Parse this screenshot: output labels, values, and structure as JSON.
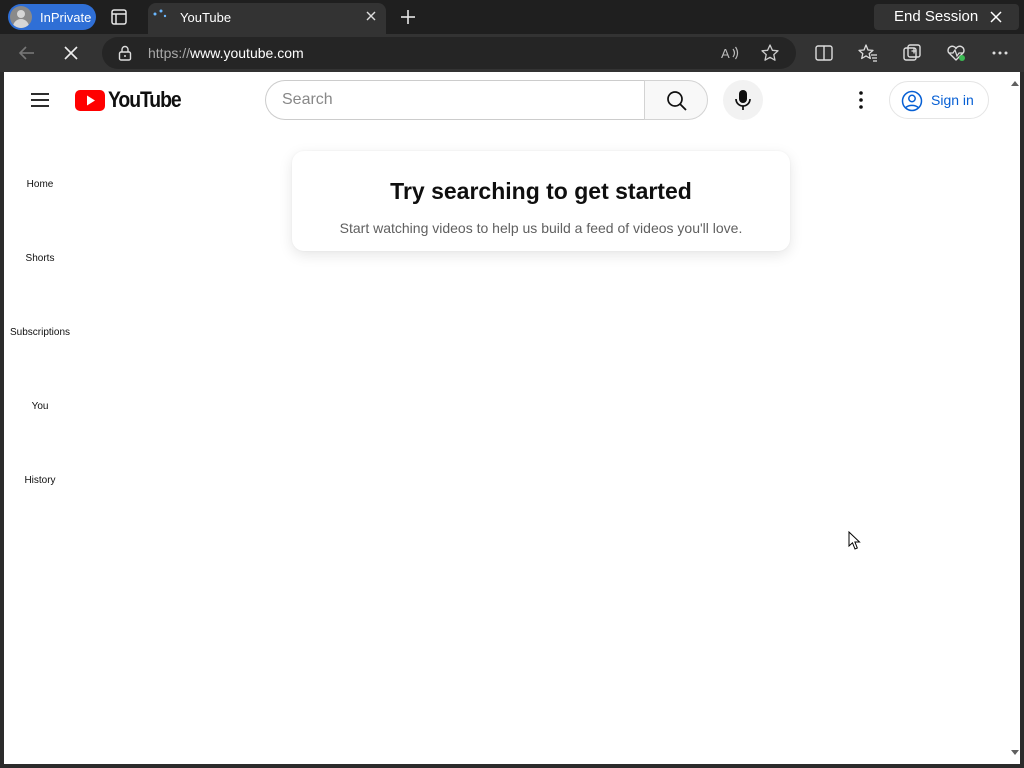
{
  "browser": {
    "inprivate_label": "InPrivate",
    "tab": {
      "title": "YouTube"
    },
    "end_session_label": "End Session",
    "address": {
      "protocol": "https://",
      "host": "www.youtube.com"
    }
  },
  "youtube": {
    "logo_text": "YouTube",
    "search": {
      "placeholder": "Search"
    },
    "sign_in_label": "Sign in",
    "guide": [
      {
        "label": "Home"
      },
      {
        "label": "Shorts"
      },
      {
        "label": "Subscriptions"
      },
      {
        "label": "You"
      },
      {
        "label": "History"
      }
    ],
    "prompt": {
      "title": "Try searching to get started",
      "subtitle": "Start watching videos to help us build a feed of videos you'll love."
    }
  },
  "colors": {
    "accent_blue": "#065fd4",
    "brand_red": "#ff0000",
    "inprivate_blue": "#2f6fd6"
  }
}
